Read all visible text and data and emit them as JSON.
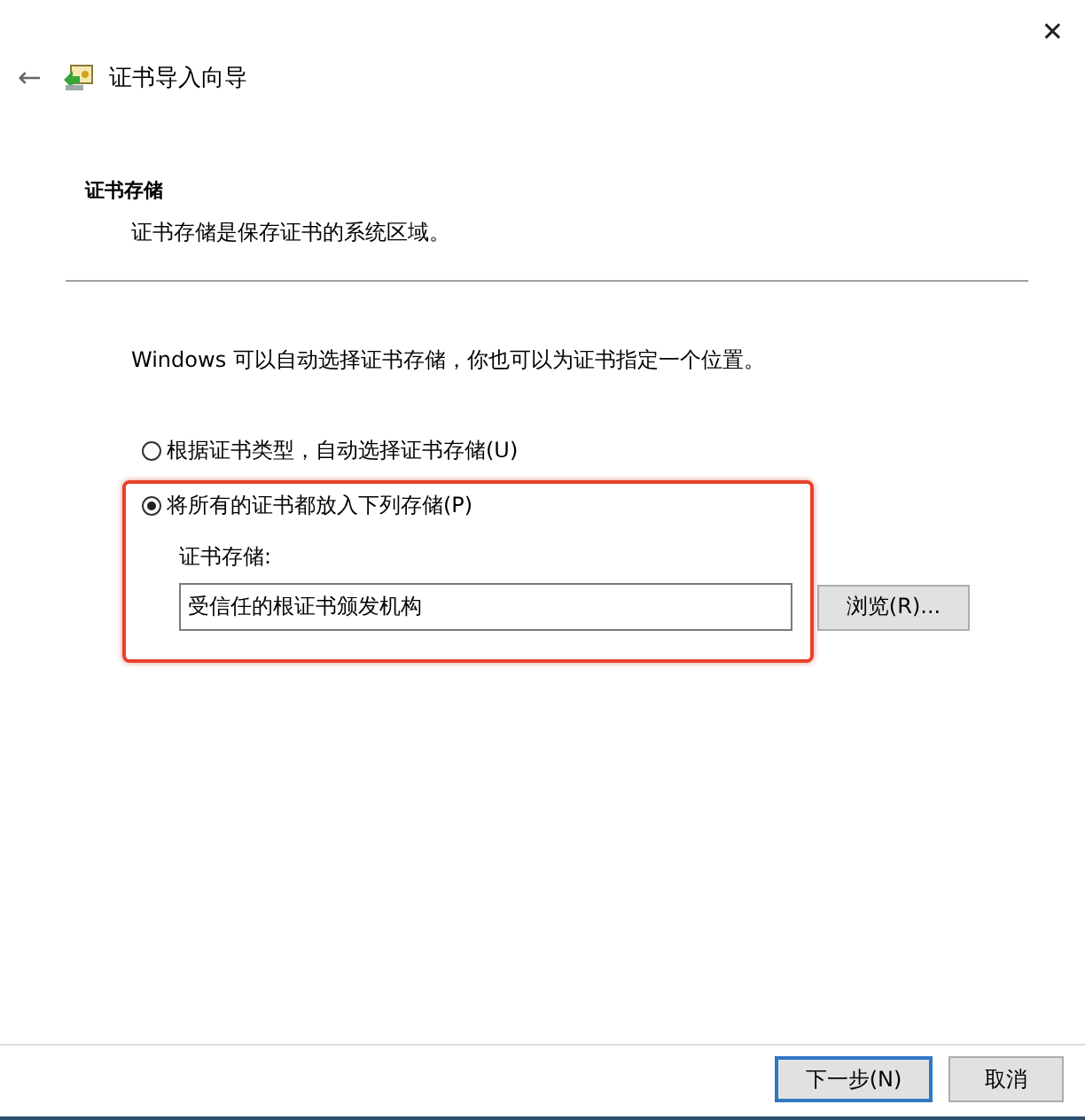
{
  "window": {
    "close": "✕",
    "back": "←",
    "title": "证书导入向导"
  },
  "section": {
    "heading": "证书存储",
    "description": "证书存储是保存证书的系统区域。"
  },
  "intro": "Windows 可以自动选择证书存储，你也可以为证书指定一个位置。",
  "options": [
    {
      "label": "根据证书类型，自动选择证书存储(U)",
      "selected": false,
      "highlighted": false
    },
    {
      "label": "将所有的证书都放入下列存储(P)",
      "selected": true,
      "highlighted": true
    }
  ],
  "store": {
    "label": "证书存储:",
    "value": "受信任的根证书颁发机构",
    "browse": "浏览(R)..."
  },
  "buttons": [
    {
      "label": "下一步(N)",
      "default": true
    },
    {
      "label": "取消",
      "default": false
    }
  ]
}
